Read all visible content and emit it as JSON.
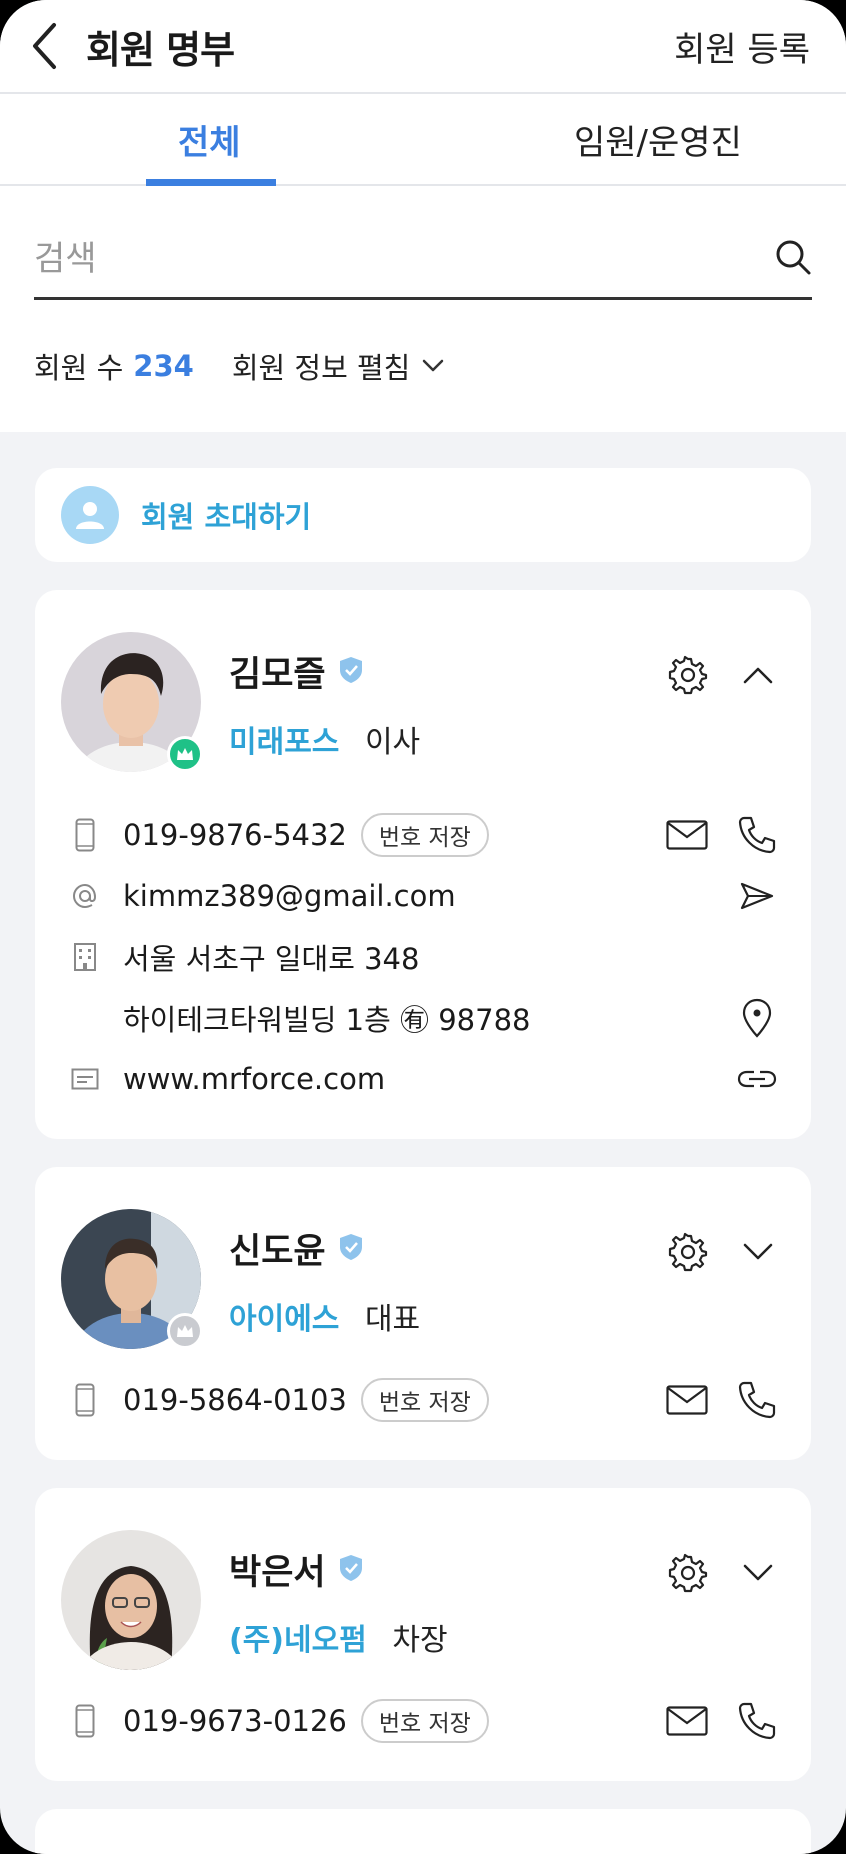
{
  "header": {
    "title": "회원 명부",
    "register_label": "회원 등록"
  },
  "tabs": [
    {
      "label": "전체",
      "active": true
    },
    {
      "label": "임원/운영진",
      "active": false
    }
  ],
  "search": {
    "placeholder": "검색"
  },
  "summary": {
    "count_label": "회원 수",
    "count_value": "234",
    "toggle_label": "회원 정보 펼침"
  },
  "invite": {
    "label": "회원 초대하기"
  },
  "accent_color": "#3b7fe0",
  "members": [
    {
      "name": "김모즐",
      "company": "미래포스",
      "title": "이사",
      "badge": "crown-green",
      "expanded": true,
      "phone": "019-9876-5432",
      "save_label": "번호 저장",
      "email": "kimmz389@gmail.com",
      "address_line1": "서울 서초구 일대로 348",
      "address_line2": "하이테크타워빌딩 1층 ㊒ 98788",
      "website": "www.mrforce.com"
    },
    {
      "name": "신도윤",
      "company": "아이에스",
      "title": "대표",
      "badge": "crown-grey",
      "expanded": false,
      "phone": "019-5864-0103",
      "save_label": "번호 저장"
    },
    {
      "name": "박은서",
      "company": "(주)네오펌",
      "title": "차장",
      "badge": "none",
      "expanded": false,
      "phone": "019-9673-0126",
      "save_label": "번호 저장"
    }
  ]
}
